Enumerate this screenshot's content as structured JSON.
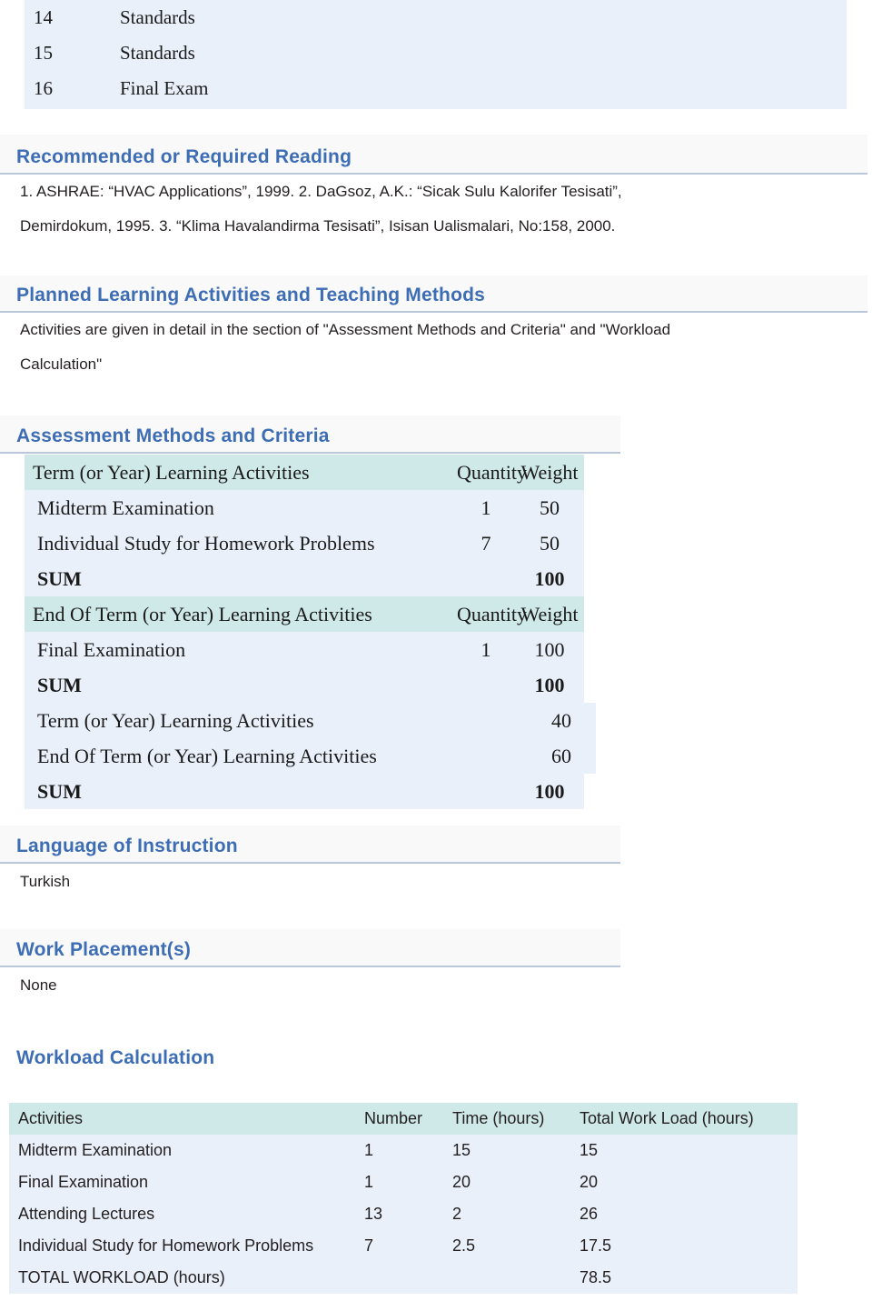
{
  "top_list": {
    "rows": [
      {
        "week": "14",
        "topic": "Standards"
      },
      {
        "week": "15",
        "topic": "Standards"
      },
      {
        "week": "16",
        "topic": "Final Exam"
      }
    ]
  },
  "reading": {
    "heading": "Recommended or Required Reading",
    "line1": "1. ASHRAE: “HVAC Applications”, 1999. 2. DaGsoz, A.K.: “Sicak Sulu Kalorifer Tesisati”,",
    "line2": "Demirdokum, 1995. 3. “Klima Havalandirma Tesisati”, Isisan Ualismalari, No:158, 2000."
  },
  "planned": {
    "heading": "Planned Learning Activities and Teaching Methods",
    "line1": "Activities are given in detail in the section of \"Assessment Methods and Criteria\" and \"Workload",
    "line2": "Calculation\""
  },
  "assessment": {
    "heading": "Assessment Methods and Criteria",
    "term_header": {
      "activities": "Term (or Year) Learning Activities",
      "quantity": "Quantity",
      "weight": "Weight"
    },
    "term_rows": [
      {
        "activity": "Midterm Examination",
        "quantity": "1",
        "weight": "50"
      },
      {
        "activity": "Individual Study for Homework Problems",
        "quantity": "7",
        "weight": "50"
      }
    ],
    "term_sum": {
      "label": "SUM",
      "quantity": "",
      "weight": "100"
    },
    "end_header": {
      "activities": "End Of Term (or Year) Learning Activities",
      "quantity": "Quantity",
      "weight": "Weight"
    },
    "end_rows": [
      {
        "activity": "Final Examination",
        "quantity": "1",
        "weight": "100"
      }
    ],
    "end_sum": {
      "label": "SUM",
      "quantity": "",
      "weight": "100"
    },
    "overall_rows": [
      {
        "activity": "Term (or Year) Learning Activities",
        "quantity": "",
        "weight": "40"
      },
      {
        "activity": "End Of Term (or Year) Learning Activities",
        "quantity": "",
        "weight": "60"
      }
    ],
    "overall_sum": {
      "label": "SUM",
      "quantity": "",
      "weight": "100"
    }
  },
  "language": {
    "heading": "Language of Instruction",
    "value": "Turkish"
  },
  "work_placement": {
    "heading": "Work Placement(s)",
    "value": "None"
  },
  "workload": {
    "heading": "Workload Calculation",
    "columns": {
      "activities": "Activities",
      "number": "Number",
      "time": "Time (hours)",
      "total": "Total Work Load (hours)"
    },
    "rows": [
      {
        "activity": "Midterm Examination",
        "number": "1",
        "time": "15",
        "total": "15"
      },
      {
        "activity": "Final Examination",
        "number": "1",
        "time": "20",
        "total": "20"
      },
      {
        "activity": "Attending Lectures",
        "number": "13",
        "time": "2",
        "total": "26"
      },
      {
        "activity": "Individual Study for Homework Problems",
        "number": "7",
        "time": "2.5",
        "total": "17.5"
      }
    ],
    "total_row": {
      "activity": "TOTAL WORKLOAD (hours)",
      "number": "",
      "time": "",
      "total": "78.5"
    }
  },
  "colors": {
    "heading_blue": "#3d6db4",
    "table_header_teal": "#cfe8e8",
    "table_row_blue": "#e9f0fa",
    "band_gray": "#f9f9f9",
    "rule_gray": "#b9c7d8"
  }
}
